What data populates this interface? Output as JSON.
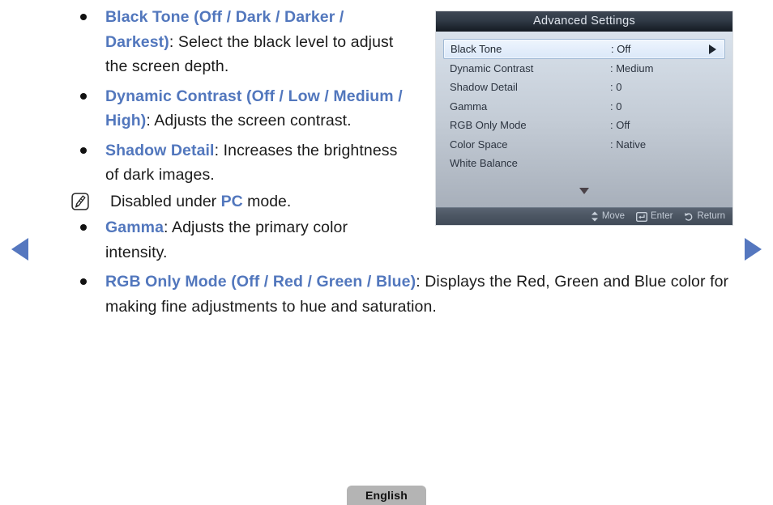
{
  "navigation": {
    "prev_label": "Previous page",
    "next_label": "Next page"
  },
  "content": {
    "bullets": [
      {
        "term": "Black Tone (Off / Dark / Darker / Darkest)",
        "text": ": Select the black level to adjust the screen depth."
      },
      {
        "term": "Dynamic Contrast (Off / Low / Medium / High)",
        "text": ": Adjusts the screen contrast."
      },
      {
        "term": "Shadow Detail",
        "text": ": Increases the brightness of dark images."
      },
      {
        "term": "Gamma",
        "text": ": Adjusts the primary color intensity."
      },
      {
        "term": "RGB Only Mode (Off / Red / Green / Blue)",
        "text": ": Displays the Red, Green and Blue color for making fine adjustments to hue and saturation."
      }
    ],
    "note": {
      "icon": "note-icon",
      "prefix": "Disabled under ",
      "keyword": "PC",
      "suffix": " mode."
    }
  },
  "osd": {
    "title": "Advanced Settings",
    "rows": [
      {
        "label": "Black Tone",
        "value": ": Off",
        "selected": true
      },
      {
        "label": "Dynamic Contrast",
        "value": ": Medium",
        "selected": false
      },
      {
        "label": "Shadow Detail",
        "value": ": 0",
        "selected": false
      },
      {
        "label": "Gamma",
        "value": ": 0",
        "selected": false
      },
      {
        "label": "RGB Only Mode",
        "value": ": Off",
        "selected": false
      },
      {
        "label": "Color Space",
        "value": ": Native",
        "selected": false
      },
      {
        "label": "White Balance",
        "value": "",
        "selected": false
      }
    ],
    "scroll_indicator": "more-items-below",
    "footer": [
      {
        "icon": "up-down-arrows-icon",
        "label": "Move"
      },
      {
        "icon": "enter-key-icon",
        "label": "Enter"
      },
      {
        "icon": "return-arrow-icon",
        "label": "Return"
      }
    ]
  },
  "footer": {
    "language": "English"
  },
  "colors": {
    "link_blue": "#5277bd",
    "nav_arrow_blue": "#5577bf",
    "osd_title_bar": "#2b333f",
    "body_text": "#1b1b1b"
  }
}
